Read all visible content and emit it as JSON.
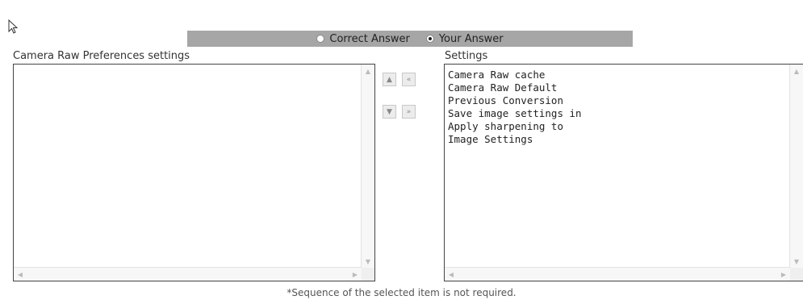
{
  "answer_toggle": {
    "correct_label": "Correct Answer",
    "yours_label": "Your Answer",
    "selected": "Your Answer"
  },
  "left_panel": {
    "label": "Camera Raw Preferences settings",
    "items": []
  },
  "right_panel": {
    "label": "Settings",
    "items": [
      "Camera Raw cache",
      "Camera Raw Default",
      "Previous Conversion",
      "Save image settings in",
      "Apply sharpening to",
      "Image Settings"
    ]
  },
  "controls": {
    "move_up": "▲",
    "move_all_left": "«",
    "move_down": "▼",
    "move_all_right": "»"
  },
  "icons": {
    "scroll_up": "▲",
    "scroll_down": "▼",
    "scroll_left": "◀",
    "scroll_right": "▶"
  },
  "footnote": "*Sequence of the selected item is not required."
}
